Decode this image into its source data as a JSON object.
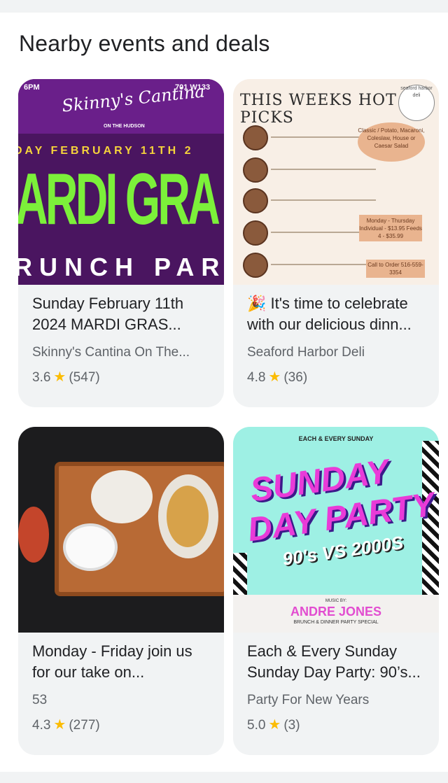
{
  "section": {
    "title": "Nearby events and deals"
  },
  "cards": [
    {
      "title": "Sunday February 11th 2024 MARDI GRAS...",
      "source": "Skinny's Cantina On The...",
      "rating": "3.6",
      "reviews": "(547)",
      "poster": {
        "time": "6PM",
        "address": "701 W133",
        "brand": "Skinny's Cantina",
        "brand_sub": "ON THE HUDSON",
        "date_line": "DAY FEBRUARY 11TH 2",
        "headline": "ARDI GRA",
        "subline": "RUNCH PART"
      }
    },
    {
      "title": "🎉 It's time to celebrate with our delicious dinn...",
      "source": "Seaford Harbor Deli",
      "rating": "4.8",
      "reviews": "(36)",
      "poster": {
        "header": "THIS WEEKS HOT PICKS",
        "logo_text": "seaford harbor deli",
        "side_text": "Classic / Potato, Macaroni, Coleslaw, House or Caesar Salad",
        "price_text": "Monday - Thursday Individual - $13.95 Feeds 4 - $35.99",
        "call_text": "Call to Order 516-559-3354"
      }
    },
    {
      "title": "Monday - Friday join us for our take on...",
      "source": "53",
      "rating": "4.3",
      "reviews": "(277)"
    },
    {
      "title": "Each & Every Sunday Sunday Day Party: 90’s...",
      "source": "Party For New Years",
      "rating": "5.0",
      "reviews": "(3)",
      "poster": {
        "top_line": "EACH & EVERY SUNDAY",
        "line1": "SUNDAY",
        "line2": "DAY PARTY",
        "vs": "90's VS 2000S",
        "music_by": "MUSIC BY:",
        "dj": "ANDRE JONES",
        "special": "BRUNCH & DINNER PARTY SPECIAL"
      }
    }
  ],
  "icons": {
    "rating": "star-icon",
    "star_color": "#fbbc04"
  }
}
